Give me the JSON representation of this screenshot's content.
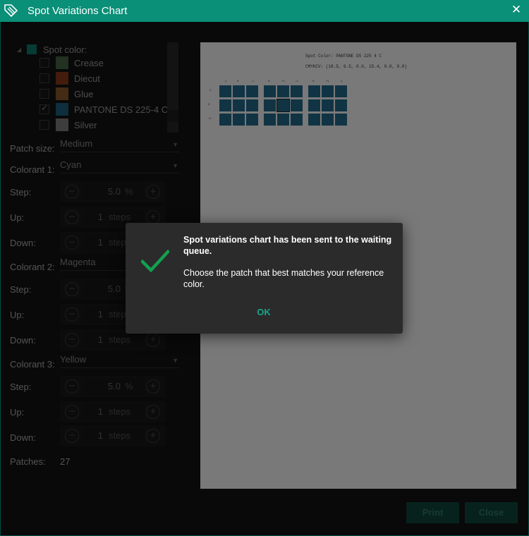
{
  "window": {
    "title": "Spot Variations Chart"
  },
  "tree": {
    "root_label": "Spot color:",
    "items": [
      {
        "label": "Crease",
        "color": "#4a6a46",
        "checked": false
      },
      {
        "label": "Diecut",
        "color": "#8a3a1e",
        "checked": false
      },
      {
        "label": "Glue",
        "color": "#8a5a2a",
        "checked": false
      },
      {
        "label": "PANTONE DS 225-4 C",
        "color": "#1e5f7d",
        "checked": true
      },
      {
        "label": "Silver",
        "color": "#8a8a8a",
        "checked": false
      }
    ]
  },
  "form": {
    "patch_size_label": "Patch size:",
    "patch_size_value": "Medium",
    "colorant1_label": "Colorant 1:",
    "colorant1_value": "Cyan",
    "colorant2_label": "Colorant 2:",
    "colorant2_value": "Magenta",
    "colorant3_label": "Colorant 3:",
    "colorant3_value": "Yellow",
    "step_label": "Step:",
    "up_label": "Up:",
    "down_label": "Down:",
    "step_value": "5.0",
    "step_unit": "%",
    "updown_value": "1",
    "updown_unit": "steps",
    "patches_label": "Patches:",
    "patches_value": "27"
  },
  "preview": {
    "line1": "Spot Color: PANTONE DS 225 4 C",
    "line2": "CMYKCV: (18.5, 6.5, 0.0, 15.4, 0.0, 0.0)",
    "col_headers": [
      "-1",
      "0",
      "",
      "-1",
      "0",
      "+1",
      "",
      "-1",
      "0",
      "+1"
    ],
    "row_headers": [
      "-1",
      "0",
      "+1"
    ]
  },
  "footer": {
    "print_label": "Print",
    "close_label": "Close"
  },
  "modal": {
    "message1": "Spot variations chart has been sent to the waiting queue.",
    "message2": "Choose the patch that best matches your reference color.",
    "ok_label": "OK",
    "accent": "#16a48a"
  }
}
